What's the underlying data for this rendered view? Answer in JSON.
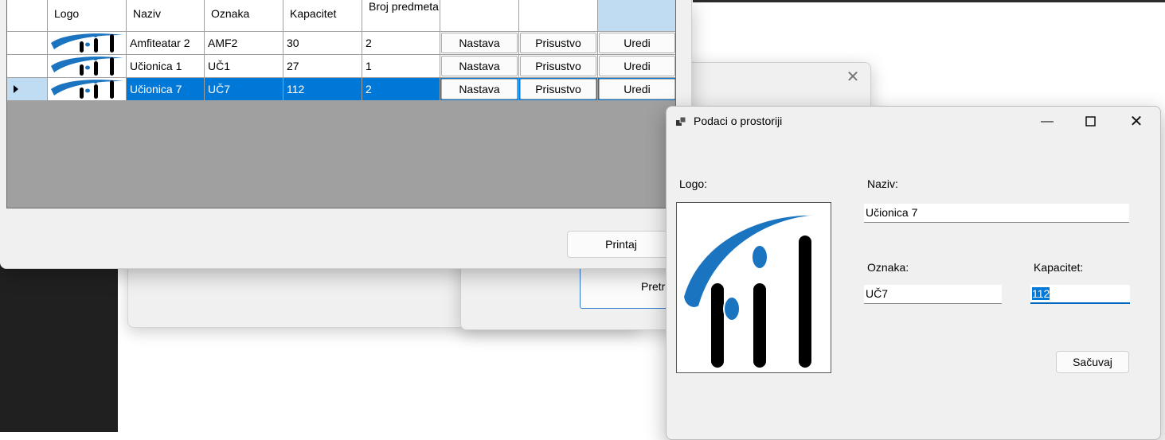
{
  "grid": {
    "columns": [
      "",
      "Logo",
      "Naziv",
      "Oznaka",
      "Kapacitet",
      "Broj predmeta",
      "",
      "",
      ""
    ],
    "rows": [
      {
        "naziv": "Amfiteatar 2",
        "oznaka": "AMF2",
        "kapacitet": "30",
        "broj_predmeta": "2",
        "selected": false
      },
      {
        "naziv": "Učionica 1",
        "oznaka": "UČ1",
        "kapacitet": "27",
        "broj_predmeta": "1",
        "selected": false
      },
      {
        "naziv": "Učionica 7",
        "oznaka": "UČ7",
        "kapacitet": "112",
        "broj_predmeta": "2",
        "selected": true
      }
    ],
    "buttons": {
      "nastava": "Nastava",
      "prisustvo": "Prisustvo",
      "uredi": "Uredi"
    }
  },
  "main_window": {
    "print_label": "Printaj"
  },
  "background": {
    "search_button_label": "Pretraži"
  },
  "dialog": {
    "title": "Podaci o prostoriji",
    "logo_label": "Logo:",
    "naziv_label": "Naziv:",
    "naziv_value": "Učionica 7",
    "oznaka_label": "Oznaka:",
    "oznaka_value": "UČ7",
    "kapacitet_label": "Kapacitet:",
    "kapacitet_value": "112",
    "save_label": "Sačuvaj"
  },
  "colors": {
    "selection": "#0078d7",
    "logo_blue": "#1a74c0",
    "accent": "#0067c0"
  }
}
